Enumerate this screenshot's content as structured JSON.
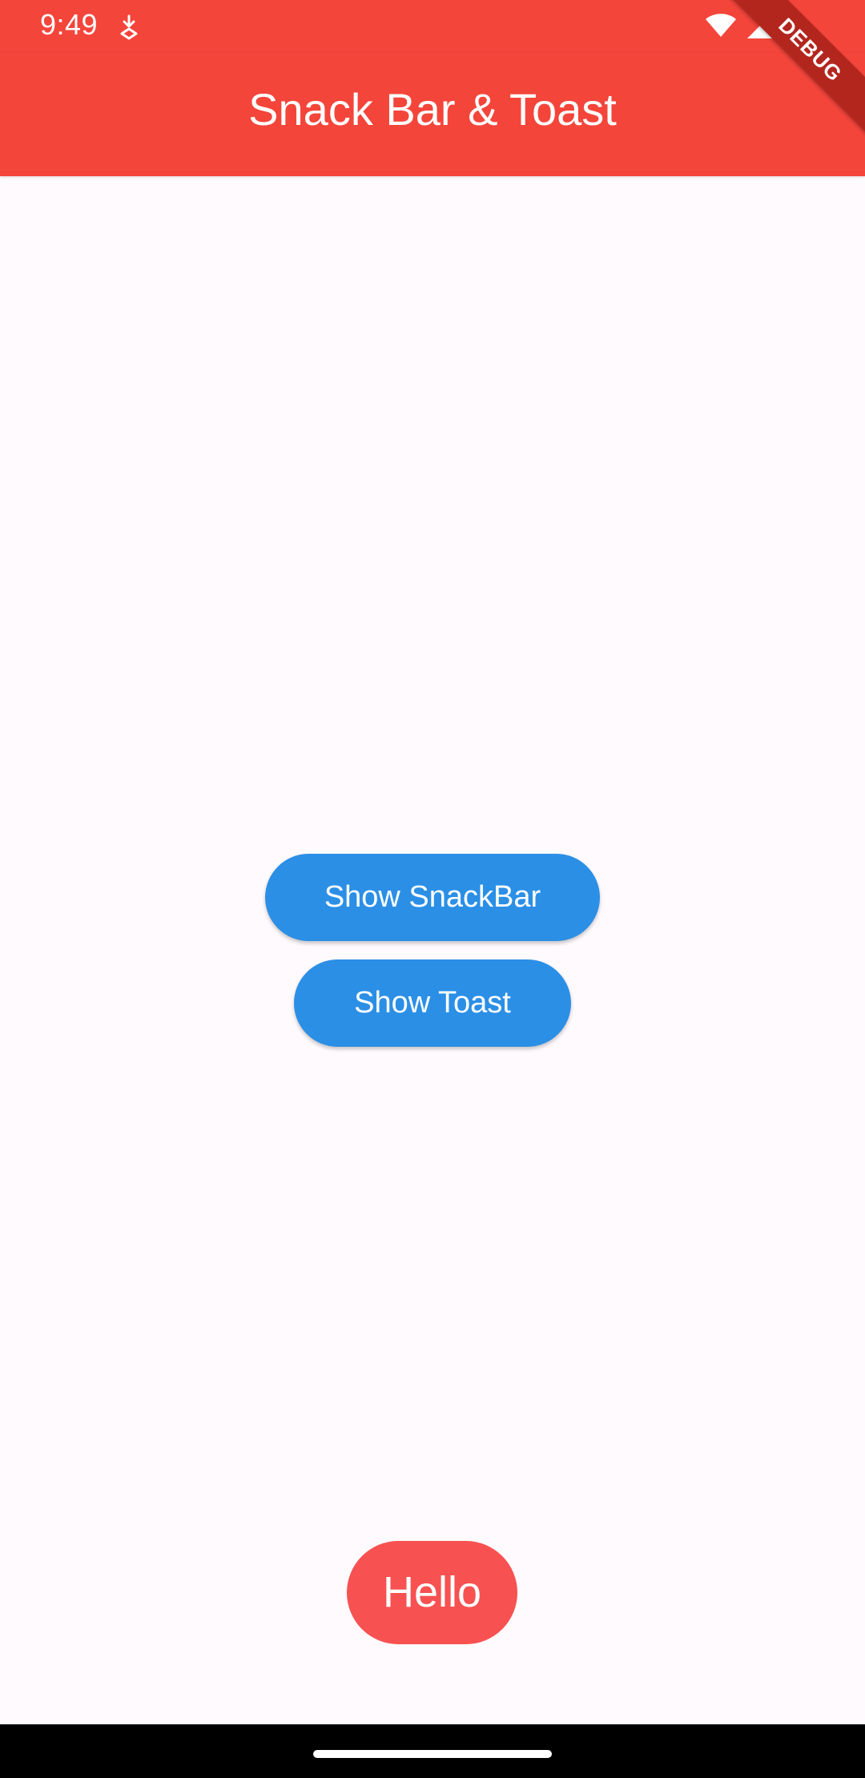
{
  "status_bar": {
    "time": "9:49",
    "notification_icon": "download-notification-icon",
    "icons": [
      "wifi-icon",
      "cellular-signal-icon",
      "battery-icon"
    ]
  },
  "app_bar": {
    "title": "Snack Bar & Toast",
    "color": "#f4453b"
  },
  "debug_banner": {
    "label": "DEBUG"
  },
  "main": {
    "buttons": [
      {
        "label": "Show SnackBar"
      },
      {
        "label": "Show Toast"
      }
    ],
    "button_color": "#2b8fe6"
  },
  "toast": {
    "message": "Hello",
    "color": "#f85151"
  },
  "nav_bar": {
    "home_indicator": "home-indicator"
  }
}
